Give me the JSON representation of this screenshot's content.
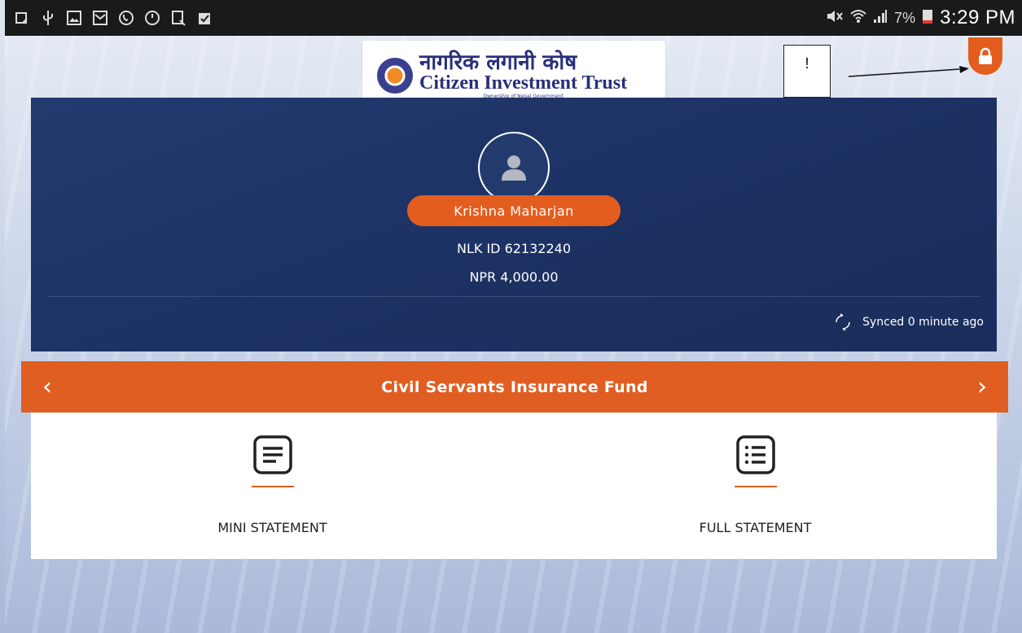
{
  "status_bar": {
    "battery": "7%",
    "time": "3:29 PM"
  },
  "logo": {
    "nepali": "नागरिक लगानी कोष",
    "english": "Citizen Investment Trust",
    "sub": "Ownership of Nepal Government"
  },
  "annotation": {
    "mark": "!"
  },
  "profile": {
    "name": "Krishna  Maharjan",
    "nlk_id": "NLK ID 62132240",
    "balance": "NPR 4,000.00",
    "sync_status": "Synced 0 minute ago"
  },
  "fund_selector": {
    "title": "Civil Servants Insurance Fund"
  },
  "actions": {
    "mini_statement": "MINI STATEMENT",
    "full_statement": "FULL STATEMENT"
  },
  "colors": {
    "accent": "#e05e22",
    "hero_bg": "#1d3264",
    "statusbar": "#1a1a1a"
  }
}
